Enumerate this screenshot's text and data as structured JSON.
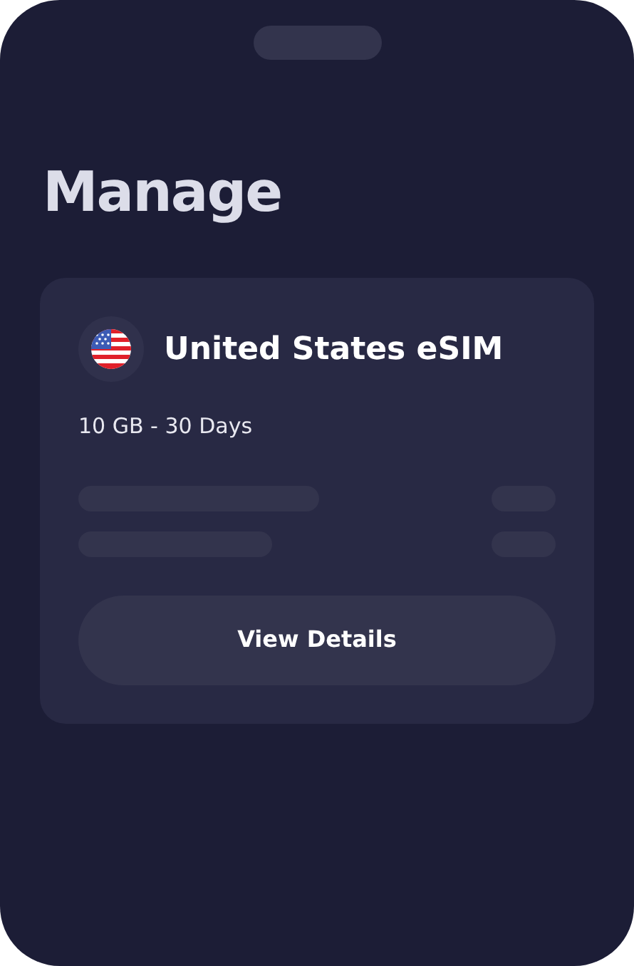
{
  "page": {
    "title": "Manage"
  },
  "esim_card": {
    "name": "United States eSIM",
    "plan": "10 GB - 30 Days",
    "button": "View Details"
  }
}
